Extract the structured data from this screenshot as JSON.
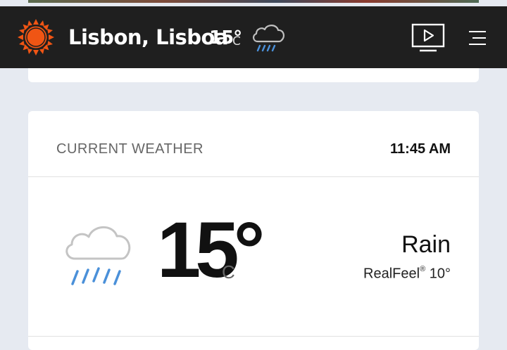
{
  "header": {
    "location": "Lisbon, Lisboa",
    "temperature": "15°",
    "unit": "C",
    "icons": {
      "brand": "sun-icon",
      "condition": "rain-cloud-icon",
      "video": "video-play-icon",
      "menu": "hamburger-menu-icon"
    },
    "colors": {
      "background": "#1f1f1f",
      "brand_orange": "#f05514",
      "rain_blue": "#4a90d9"
    }
  },
  "current_weather": {
    "title": "CURRENT WEATHER",
    "time": "11:45 AM",
    "temperature": "15°",
    "unit": "C",
    "phrase": "Rain",
    "realfeel_label": "RealFeel",
    "realfeel_mark": "®",
    "realfeel_value": "10°",
    "icon": "rain-cloud-icon"
  }
}
